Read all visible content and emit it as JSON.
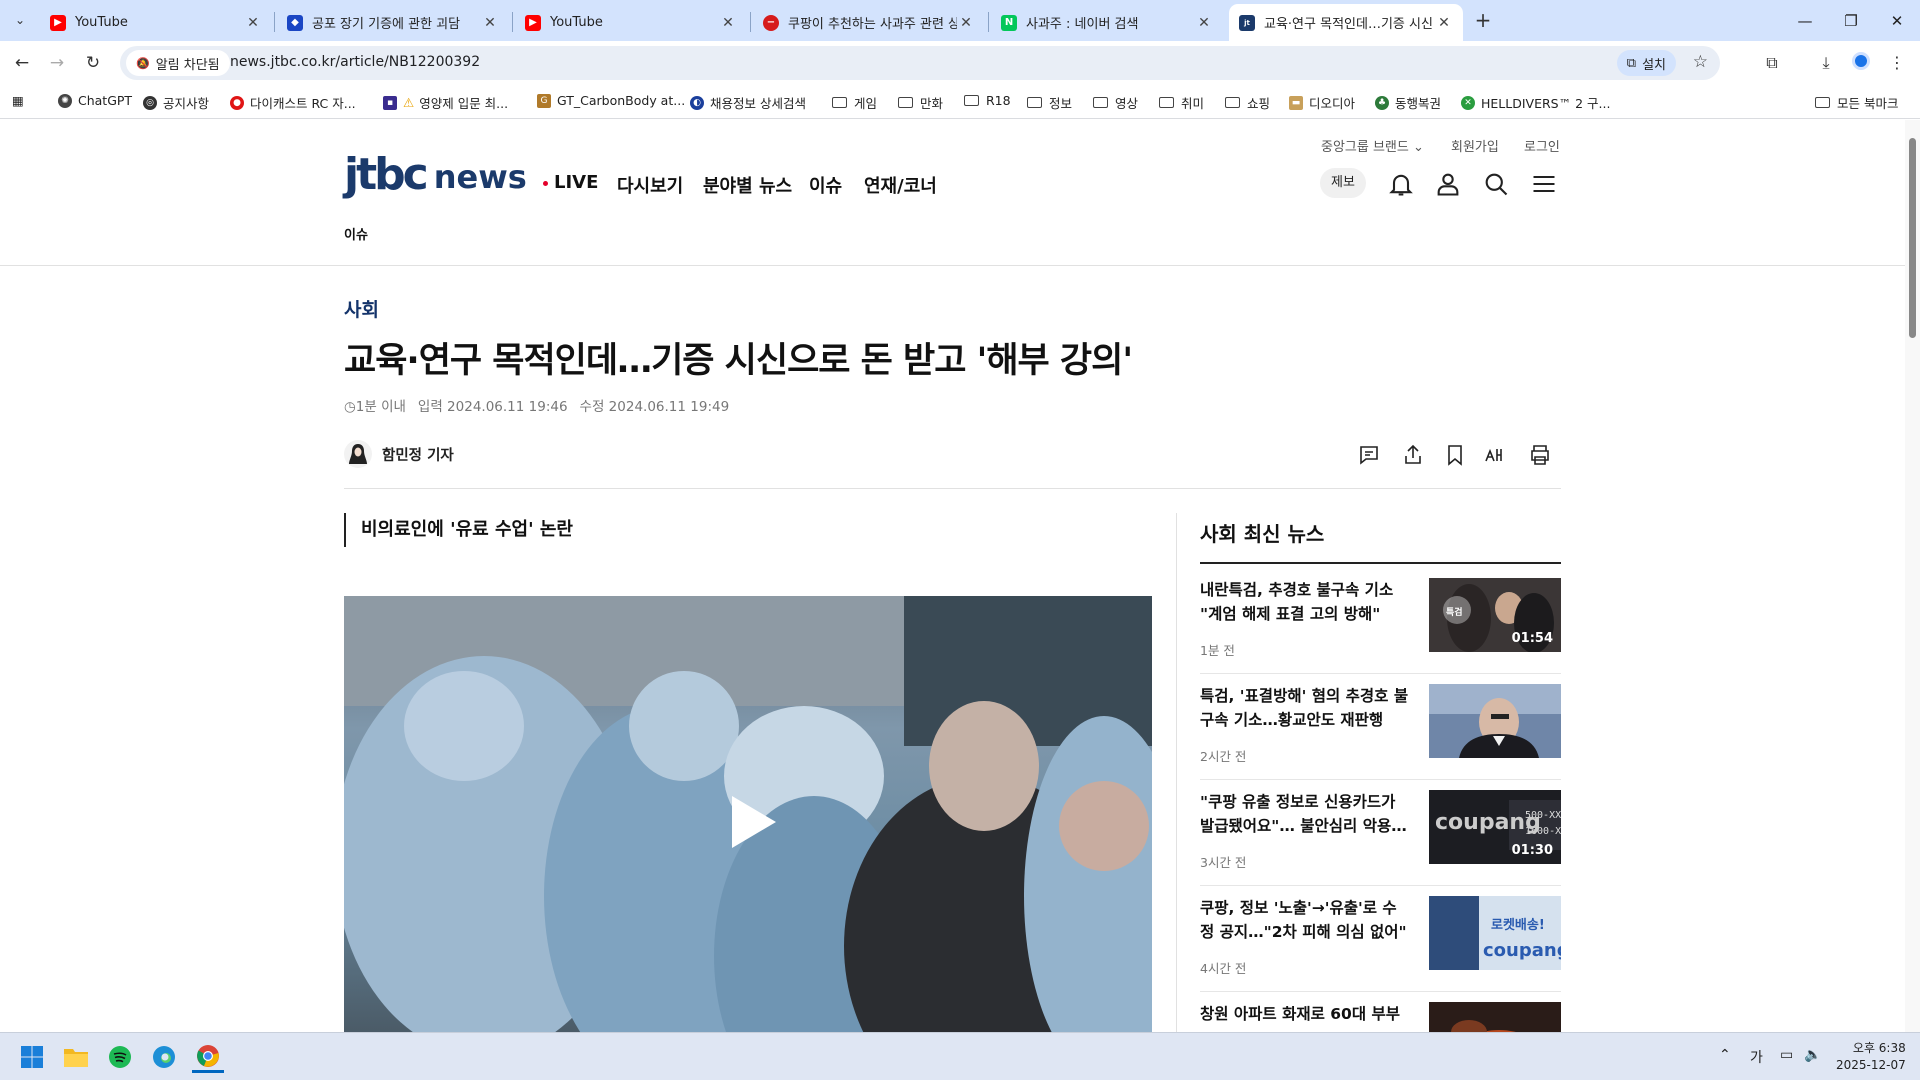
{
  "tabs": [
    {
      "title": "YouTube",
      "active": false
    },
    {
      "title": "공포 장기 기증에 관한 괴담",
      "active": false
    },
    {
      "title": "YouTube",
      "active": false
    },
    {
      "title": "쿠팡이 추천하는 사과주 관련 상",
      "active": false
    },
    {
      "title": "사과주 : 네이버 검색",
      "active": false
    },
    {
      "title": "교육·연구 목적인데…기증 시신",
      "active": true
    }
  ],
  "toolbar": {
    "site_chip": "알림 차단됨",
    "url": "news.jtbc.co.kr/article/NB12200392",
    "install_label": "설치"
  },
  "bookmarks": [
    {
      "label": "ChatGPT",
      "icon": "chatgpt-icon"
    },
    {
      "label": "공지사항",
      "icon": "globe-icon"
    },
    {
      "label": "다이캐스트 RC 자...",
      "icon": "site-icon"
    },
    {
      "label": "영양제 입문 최...",
      "icon": "warning-icon"
    },
    {
      "label": "GT_CarbonBody at...",
      "icon": "site-icon"
    },
    {
      "label": "채용정보 상세검색",
      "icon": "site-icon"
    },
    {
      "label": "게임",
      "icon": "folder-icon"
    },
    {
      "label": "만화",
      "icon": "folder-icon"
    },
    {
      "label": "R18",
      "icon": "folder-icon"
    },
    {
      "label": "정보",
      "icon": "folder-icon"
    },
    {
      "label": "영상",
      "icon": "folder-icon"
    },
    {
      "label": "취미",
      "icon": "folder-icon"
    },
    {
      "label": "쇼핑",
      "icon": "folder-icon"
    },
    {
      "label": "디오디아",
      "icon": "site-icon"
    },
    {
      "label": "동행복권",
      "icon": "site-icon"
    },
    {
      "label": "HELLDIVERS™ 2 구...",
      "icon": "site-icon"
    }
  ],
  "all_bookmarks": "모든 북마크",
  "site": {
    "logo_jtbc": "jtbc",
    "logo_news": "news",
    "nav": [
      "LIVE",
      "다시보기",
      "분야별 뉴스",
      "이슈",
      "연재/코너"
    ],
    "utils": [
      "중앙그룹 브랜드",
      "회원가입",
      "로그인"
    ],
    "report_btn": "제보",
    "subnav": "이슈"
  },
  "article": {
    "section": "사회",
    "headline": "교육·연구 목적인데…기증 시신으로 돈 받고 '해부 강의'",
    "read_time": "1분 이내",
    "published": "입력 2024.06.11 19:46",
    "modified": "수정 2024.06.11 19:49",
    "reporter": "함민정 기자",
    "subheading": "비의료인에 '유료 수업' 논란"
  },
  "aside": {
    "title": "사회 최신 뉴스",
    "items": [
      {
        "title": "내란특검, 추경호 불구속 기소 \"계엄 해제 표결 고의 방해\"",
        "ago": "1분 전",
        "duration": "01:54",
        "badge": "특검"
      },
      {
        "title": "특검, '표결방해' 혐의 추경호 불구속 기소…황교안도 재판행",
        "ago": "2시간 전",
        "duration": "",
        "badge": ""
      },
      {
        "title": "\"쿠팡 유출 정보로 신용카드가 발급됐어요\"… 불안심리 악용…",
        "ago": "3시간 전",
        "duration": "01:30",
        "badge": ""
      },
      {
        "title": "쿠팡, 정보 '노출'→'유출'로 수정 공지…\"2차 피해 의심 없어\"",
        "ago": "4시간 전",
        "duration": "",
        "badge": ""
      },
      {
        "title": "창원 아파트 화재로 60대 부부",
        "ago": "",
        "duration": "",
        "badge": ""
      }
    ],
    "thumb_text": {
      "coupang": "coupang",
      "rocket": "로켓배송!"
    }
  },
  "taskbar": {
    "ime": "가",
    "time": "오후 6:38",
    "date": "2025-12-07"
  }
}
